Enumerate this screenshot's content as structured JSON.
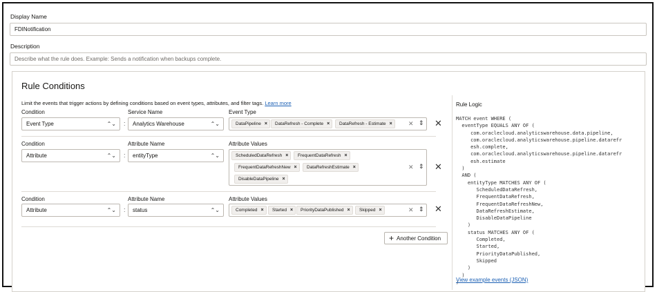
{
  "display_name": {
    "label": "Display Name",
    "value": "FDINotification"
  },
  "description": {
    "label": "Description",
    "placeholder": "Describe what the rule does. Example: Sends a notification when backups complete."
  },
  "rule_conditions": {
    "title": "Rule Conditions",
    "intro": "Limit the events that trigger actions by defining conditions based on event types, attributes, and filter tags.",
    "learn_more": "Learn more",
    "rows": [
      {
        "condition_label": "Condition",
        "condition_value": "Event Type",
        "name_label": "Service Name",
        "name_value": "Analytics Warehouse",
        "values_label": "Event Type",
        "tags": [
          "DataPipeline",
          "DataRefresh - Complete",
          "DataRefresh - Estimate"
        ]
      },
      {
        "condition_label": "Condition",
        "condition_value": "Attribute",
        "name_label": "Attribute Name",
        "name_value": "entityType",
        "values_label": "Attribute Values",
        "tags": [
          "ScheduledDataRefresh",
          "FrequentDataRefresh",
          "FrequentDataRefreshNew",
          "DataRefreshEstimate",
          "DisableDataPipeline"
        ]
      },
      {
        "condition_label": "Condition",
        "condition_value": "Attribute",
        "name_label": "Attribute Name",
        "name_value": "status",
        "values_label": "Attribute Values",
        "tags": [
          "Completed",
          "Started",
          "PriorityDataPublished",
          "Skipped"
        ]
      }
    ],
    "another_condition": "Another Condition"
  },
  "rule_logic": {
    "title": "Rule Logic",
    "code": "MATCH event WHERE (\n  eventType EQUALS ANY OF (\n     com.oraclecloud.analyticswarehouse.data.pipeline,\n     com.oraclecloud.analyticswarehouse.pipeline.datarefr\n     esh.complete,\n     com.oraclecloud.analyticswarehouse.pipeline.datarefr\n     esh.estimate\n  )\n  AND (\n    entityType MATCHES ANY OF (\n       ScheduledDataRefresh,\n       FrequentDataRefresh,\n       FrequentDataRefreshNew,\n       DataRefreshEstimate,\n       DisableDataPipeline\n    )\n    status MATCHES ANY OF (\n       Completed,\n       Started,\n       PriorityDataPublished,\n       Skipped\n    )\n  )\n)",
    "view_example": "View example events (JSON)"
  },
  "icons": {
    "chevron": "up-down-chevron-icon",
    "clear": "clear-x-icon",
    "remove": "remove-x-icon",
    "plus": "plus-icon"
  }
}
